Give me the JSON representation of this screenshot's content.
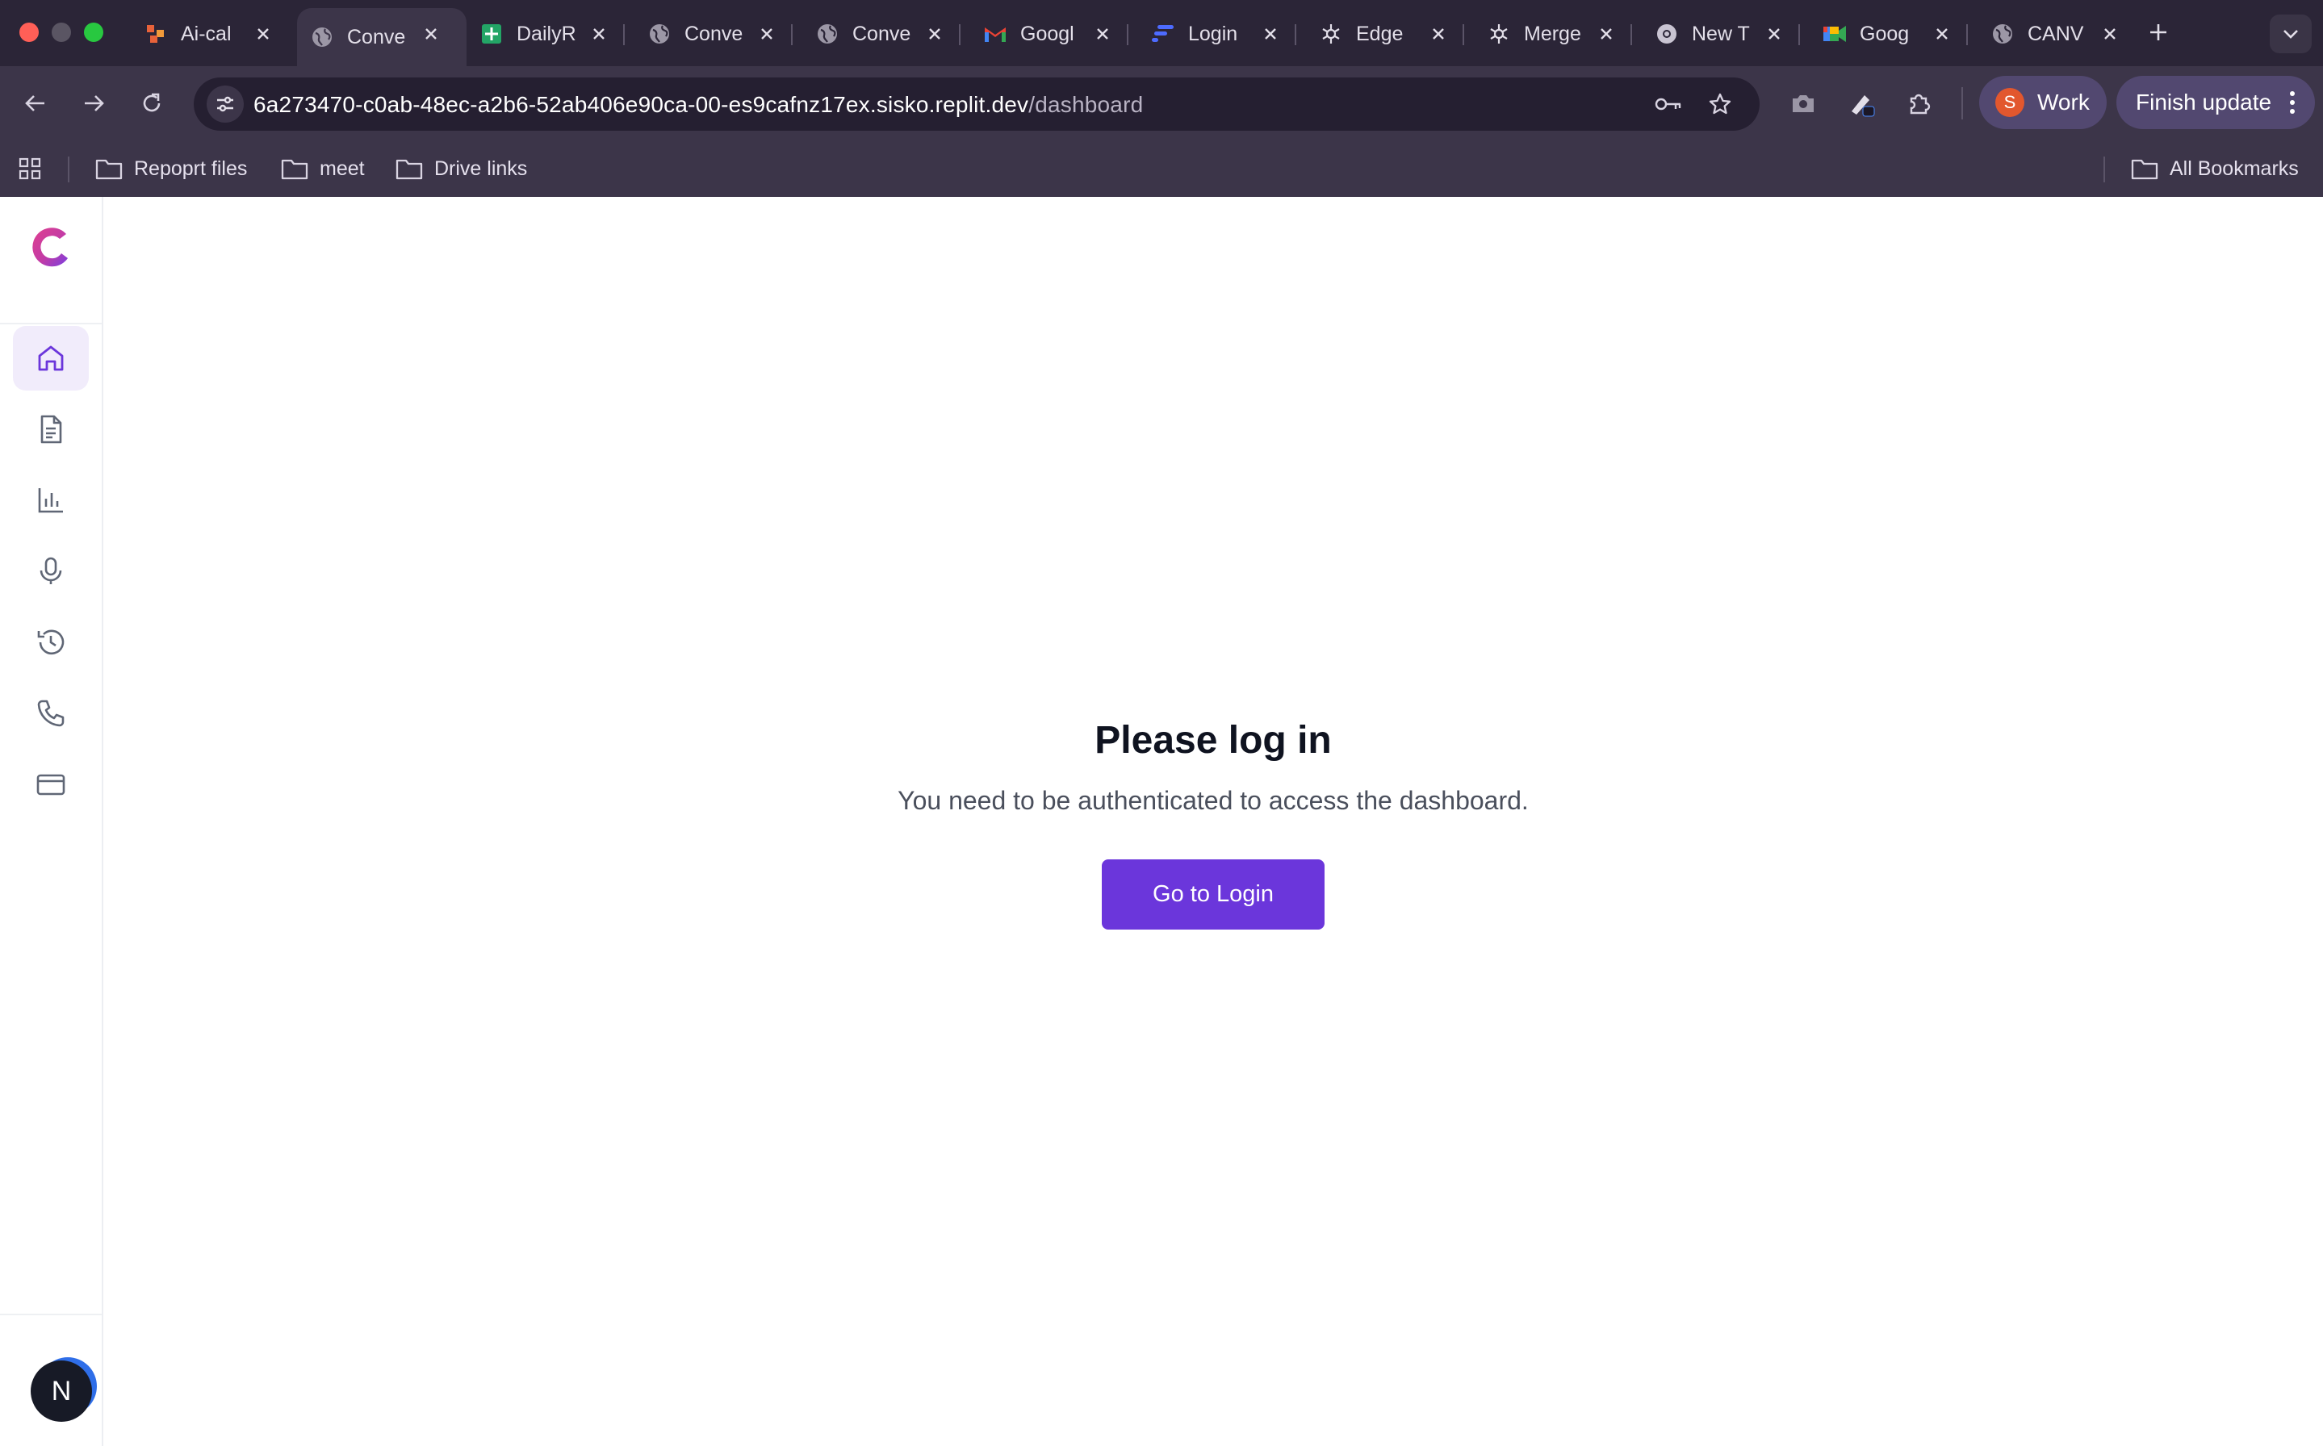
{
  "browser": {
    "tabs": [
      {
        "title": "Ai-cal",
        "icon": "orange-app-icon",
        "active": false
      },
      {
        "title": "Conve",
        "icon": "globe-icon",
        "active": true
      },
      {
        "title": "DailyR",
        "icon": "sheets-icon",
        "active": false
      },
      {
        "title": "Conve",
        "icon": "globe-icon",
        "active": false
      },
      {
        "title": "Conve",
        "icon": "globe-icon",
        "active": false
      },
      {
        "title": "Googl",
        "icon": "gmail-icon",
        "active": false
      },
      {
        "title": "Login",
        "icon": "bars-logo-icon",
        "active": false
      },
      {
        "title": "Edge",
        "icon": "openai-icon",
        "active": false
      },
      {
        "title": "Merge",
        "icon": "openai-icon",
        "active": false
      },
      {
        "title": "New T",
        "icon": "chrome-icon",
        "active": false
      },
      {
        "title": "Goog",
        "icon": "meet-icon",
        "active": false
      },
      {
        "title": "CANV",
        "icon": "globe-icon",
        "active": false
      }
    ],
    "address_bar": {
      "url_host": "6a273470-c0ab-48ec-a2b6-52ab406e90ca-00-es9cafnz17ex.sisko.replit.dev",
      "url_path": "/dashboard"
    },
    "profile": {
      "initial": "S",
      "label": "Work"
    },
    "update_button": "Finish update",
    "bookmarks": [
      {
        "label": "Repoprt files",
        "icon": "folder-icon"
      },
      {
        "label": "meet",
        "icon": "folder-icon"
      },
      {
        "label": "Drive links",
        "icon": "folder-icon"
      }
    ],
    "all_bookmarks": "All Bookmarks"
  },
  "sidebar": {
    "items": [
      {
        "name": "home",
        "icon": "home-icon",
        "active": true
      },
      {
        "name": "documents",
        "icon": "document-icon",
        "active": false
      },
      {
        "name": "analytics",
        "icon": "bar-chart-icon",
        "active": false
      },
      {
        "name": "recordings",
        "icon": "microphone-icon",
        "active": false
      },
      {
        "name": "history",
        "icon": "history-icon",
        "active": false
      },
      {
        "name": "calls",
        "icon": "phone-icon",
        "active": false
      },
      {
        "name": "billing",
        "icon": "credit-card-icon",
        "active": false
      }
    ],
    "user_initial": "N"
  },
  "main": {
    "title": "Please log in",
    "message": "You need to be authenticated to access the dashboard.",
    "button_label": "Go to Login"
  },
  "colors": {
    "accent": "#6b36db",
    "browser_dark": "#2b2537",
    "active_nav_bg": "#f1ecfb"
  }
}
